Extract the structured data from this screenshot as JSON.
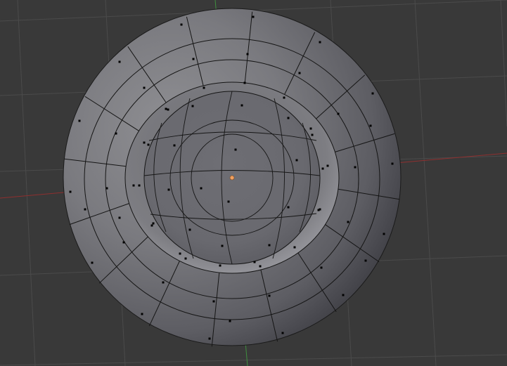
{
  "viewport": {
    "mode": "edit-mode",
    "object": "mesh-bowl",
    "colors": {
      "background": "#393939",
      "grid": "#4d4d4d",
      "x_axis": "#8f2f2f",
      "y_axis": "#3f8f3f",
      "mesh_edge": "#151515",
      "vertex": "#000000",
      "origin": "#f0a060"
    }
  }
}
